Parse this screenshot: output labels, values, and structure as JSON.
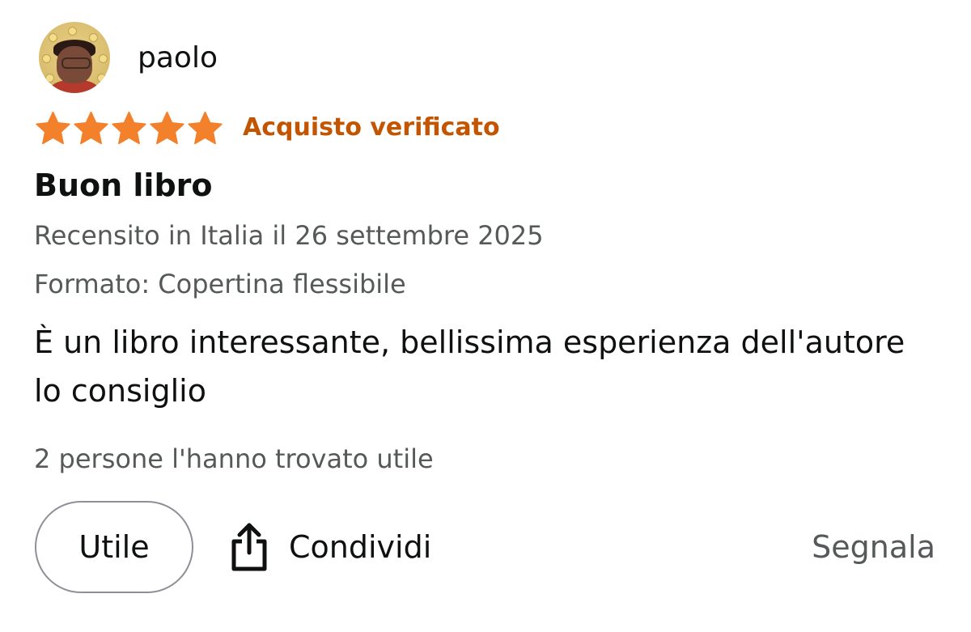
{
  "review": {
    "author": "paolo",
    "rating": 5,
    "rating_max": 5,
    "star_color": "#f3802b",
    "verified_label": "Acquisto verificato",
    "verified_color": "#c45500",
    "title": "Buon libro",
    "date_line": "Recensito in Italia il 26 settembre 2025",
    "format_line": "Formato: Copertina flessibile",
    "body": "È un libro interessante, bellissima esperienza dell'autore lo consiglio",
    "helpful_count_text": "2 persone l'hanno trovato utile"
  },
  "actions": {
    "helpful_label": "Utile",
    "share_label": "Condividi",
    "share_icon": "share-icon",
    "report_label": "Segnala"
  }
}
